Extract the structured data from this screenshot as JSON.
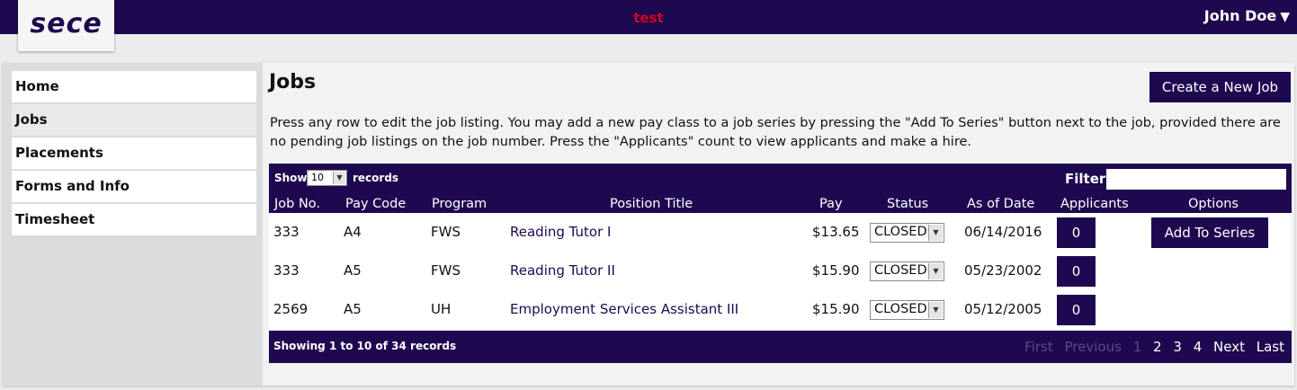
{
  "header": {
    "logo": "sece",
    "environment": "test",
    "user": "John Doe",
    "user_caret": "▼"
  },
  "sidebar": {
    "items": [
      {
        "label": "Home"
      },
      {
        "label": "Jobs"
      },
      {
        "label": "Placements"
      },
      {
        "label": "Forms and Info"
      },
      {
        "label": "Timesheet"
      }
    ],
    "active_index": 1
  },
  "main": {
    "title": "Jobs",
    "create_button": "Create a New Job",
    "intro": "Press any row to edit the job listing. You may add a new pay class to a job series by pressing the \"Add To Series\" button next to the job, provided there are no pending job listings on the job number. Press the \"Applicants\" count to view applicants and make a hire."
  },
  "table": {
    "show_label": "Show",
    "page_size": "10",
    "records_label": "records",
    "filter_label": "Filter:",
    "filter_value": "",
    "columns": [
      "Job No.",
      "Pay Code",
      "Program",
      "Position Title",
      "Pay",
      "Status",
      "As of Date",
      "Applicants",
      "Options"
    ],
    "rows": [
      {
        "job_no": "333",
        "pay_code": "A4",
        "program": "FWS",
        "title": "Reading Tutor I",
        "pay": "$13.65",
        "status": "CLOSED",
        "date": "06/14/2016",
        "applicants": "0",
        "option": "Add To Series"
      },
      {
        "job_no": "333",
        "pay_code": "A5",
        "program": "FWS",
        "title": "Reading Tutor II",
        "pay": "$15.90",
        "status": "CLOSED",
        "date": "05/23/2002",
        "applicants": "0",
        "option": ""
      },
      {
        "job_no": "2569",
        "pay_code": "A5",
        "program": "UH",
        "title": "Employment Services Assistant III",
        "pay": "$15.90",
        "status": "CLOSED",
        "date": "05/12/2005",
        "applicants": "0",
        "option": ""
      }
    ],
    "showing": "Showing 1 to 10 of 34 records",
    "pager": {
      "first": "First",
      "previous": "Previous",
      "pages": [
        "1",
        "2",
        "3",
        "4"
      ],
      "current": "1",
      "next": "Next",
      "last": "Last"
    }
  },
  "colors": {
    "primary": "#1e0950",
    "env_label": "#d0021b"
  }
}
